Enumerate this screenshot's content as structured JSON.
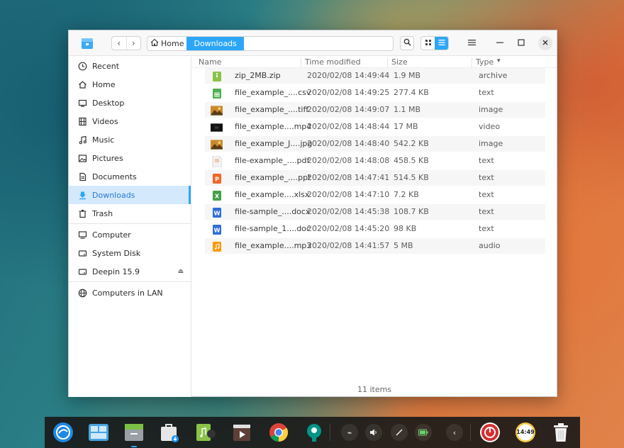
{
  "window": {
    "breadcrumb": {
      "home_label": "Home",
      "current_label": "Downloads"
    },
    "controls": {
      "back": "‹",
      "forward": "›"
    }
  },
  "sidebar": {
    "items": [
      {
        "label": "Recent",
        "icon": "clock-icon"
      },
      {
        "label": "Home",
        "icon": "home-icon"
      },
      {
        "label": "Desktop",
        "icon": "desktop-icon"
      },
      {
        "label": "Videos",
        "icon": "film-icon"
      },
      {
        "label": "Music",
        "icon": "music-note-icon"
      },
      {
        "label": "Pictures",
        "icon": "picture-icon"
      },
      {
        "label": "Documents",
        "icon": "document-icon"
      },
      {
        "label": "Downloads",
        "icon": "download-icon",
        "active": true
      },
      {
        "label": "Trash",
        "icon": "trash-icon"
      },
      {
        "label": "Computer",
        "icon": "computer-icon"
      },
      {
        "label": "System Disk",
        "icon": "disk-icon"
      },
      {
        "label": "Deepin 15.9",
        "icon": "disk-icon",
        "eject": "⏏"
      },
      {
        "label": "Computers in LAN",
        "icon": "network-icon"
      }
    ]
  },
  "list": {
    "columns": [
      "Name",
      "Time modified",
      "Size",
      "Type"
    ],
    "rows": [
      {
        "name": "zip_2MB.zip",
        "time": "2020/02/08 14:49:44",
        "size": "1.9 MB",
        "type": "archive",
        "icon": "archive-icon"
      },
      {
        "name": "file_example_....csv",
        "time": "2020/02/08 14:49:25",
        "size": "277.4 KB",
        "type": "text",
        "icon": "spreadsheet-icon"
      },
      {
        "name": "file_example_....tiff",
        "time": "2020/02/08 14:49:07",
        "size": "1.1 MB",
        "type": "image",
        "icon": "image-thumbnail-icon"
      },
      {
        "name": "file_example....mp4",
        "time": "2020/02/08 14:48:44",
        "size": "17 MB",
        "type": "video",
        "icon": "video-thumbnail-icon"
      },
      {
        "name": "file_example_J....jpg",
        "time": "2020/02/08 14:48:40",
        "size": "542.2 KB",
        "type": "image",
        "icon": "image-thumbnail-icon"
      },
      {
        "name": "file-example_....pdf",
        "time": "2020/02/08 14:48:08",
        "size": "458.5 KB",
        "type": "text",
        "icon": "pdf-icon"
      },
      {
        "name": "file_example_....ppt",
        "time": "2020/02/08 14:47:41",
        "size": "514.5 KB",
        "type": "text",
        "icon": "presentation-icon"
      },
      {
        "name": "file_example....xlsx",
        "time": "2020/02/08 14:47:10",
        "size": "7.2 KB",
        "type": "text",
        "icon": "excel-icon"
      },
      {
        "name": "file-sample_....docx",
        "time": "2020/02/08 14:45:38",
        "size": "108.7 KB",
        "type": "text",
        "icon": "word-icon"
      },
      {
        "name": "file-sample_1....doc",
        "time": "2020/02/08 14:45:20",
        "size": "98 KB",
        "type": "text",
        "icon": "word-icon"
      },
      {
        "name": "file_example....mp3",
        "time": "2020/02/08 14:41:57",
        "size": "5 MB",
        "type": "audio",
        "icon": "audio-icon"
      }
    ],
    "status": "11 items"
  },
  "dock": {
    "clock": "14:49",
    "apps": [
      "launcher-icon",
      "multitasking-icon",
      "file-manager-icon",
      "app-store-icon",
      "music-player-icon",
      "movie-player-icon",
      "chrome-icon",
      "deepin-tweak-icon"
    ],
    "tray": [
      "usb-icon",
      "volume-icon",
      "pen-icon",
      "battery-icon",
      "collapse-icon"
    ]
  },
  "colors": {
    "accent": "#2ca7f8",
    "selected_bg": "#d4e9fc",
    "dock_bg": "#181818"
  }
}
